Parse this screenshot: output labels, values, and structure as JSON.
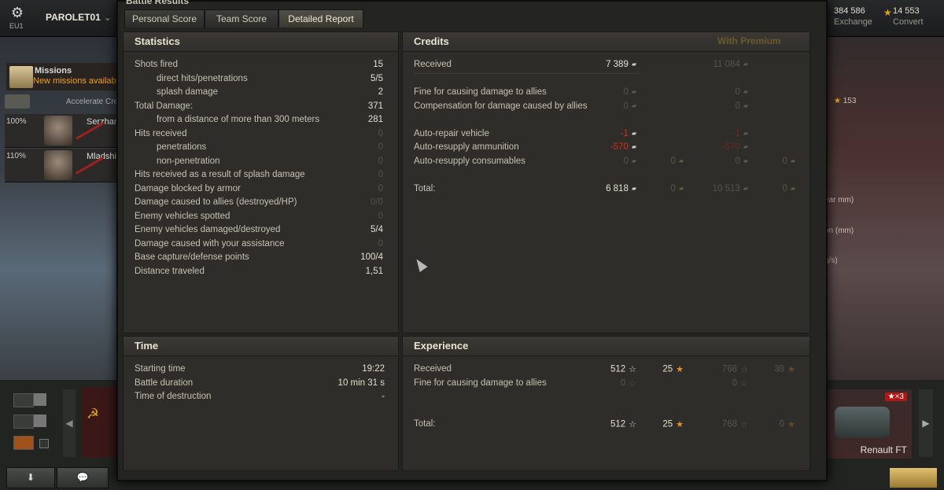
{
  "topbar": {
    "region": "EU1",
    "player": "PAROLET01",
    "silver_value": "384 586",
    "silver_label": "Exchange",
    "gold_value": "14 553",
    "gold_label": "Convert"
  },
  "left": {
    "missions_title": "Missions",
    "missions_sub": "New missions availabl",
    "accelerate": "Accelerate Crev",
    "crew": [
      {
        "pct": "100%",
        "name": "Serzhan"
      },
      {
        "pct": "110%",
        "name": "Mladshi"
      }
    ]
  },
  "right": {
    "stat_153": "153",
    "frag1": "ear mm)",
    "frag2": "on (mm)",
    "frag3": "g/s)",
    "tank_name": "Renault FT",
    "tank_xp": "×3"
  },
  "dialog": {
    "title": "Battle Results",
    "tabs": [
      "Personal Score",
      "Team Score",
      "Detailed Report"
    ]
  },
  "statistics": {
    "title": "Statistics",
    "rows": [
      {
        "label": "Shots fired",
        "value": "15",
        "indent": false,
        "bright": true
      },
      {
        "label": "direct hits/penetrations",
        "value": "5/5",
        "indent": true,
        "bright": true
      },
      {
        "label": "splash damage",
        "value": "2",
        "indent": true,
        "bright": true
      },
      {
        "label": "Total Damage:",
        "value": "371",
        "indent": false,
        "bright": true
      },
      {
        "label": "from a distance of more than 300 meters",
        "value": "281",
        "indent": true,
        "bright": true
      },
      {
        "label": "Hits received",
        "value": "0",
        "indent": false,
        "bright": false
      },
      {
        "label": "penetrations",
        "value": "0",
        "indent": true,
        "bright": false
      },
      {
        "label": "non-penetration",
        "value": "0",
        "indent": true,
        "bright": false
      },
      {
        "label": "Hits received as a result of splash damage",
        "value": "0",
        "indent": false,
        "bright": false
      },
      {
        "label": "Damage blocked by armor",
        "value": "0",
        "indent": false,
        "bright": false
      },
      {
        "label": "Damage caused to allies (destroyed/HP)",
        "value": "0/0",
        "indent": false,
        "bright": false
      },
      {
        "label": "Enemy vehicles spotted",
        "value": "0",
        "indent": false,
        "bright": false
      },
      {
        "label": "Enemy vehicles damaged/destroyed",
        "value": "5/4",
        "indent": false,
        "bright": true
      },
      {
        "label": "Damage caused with your assistance",
        "value": "0",
        "indent": false,
        "bright": false
      },
      {
        "label": "Base capture/defense points",
        "value": "100/4",
        "indent": false,
        "bright": true
      },
      {
        "label": "Distance traveled",
        "value": "1,51",
        "indent": false,
        "bright": true
      }
    ]
  },
  "credits": {
    "title": "Credits",
    "premium_label": "With Premium",
    "received": {
      "label": "Received",
      "value": "7 389",
      "premium": "11 084"
    },
    "fine": {
      "label": "Fine for causing damage to allies",
      "value": "0",
      "premium": "0"
    },
    "compensation": {
      "label": "Compensation for damage caused by allies",
      "value": "0",
      "premium": "0"
    },
    "repair": {
      "label": "Auto-repair vehicle",
      "value": "-1",
      "premium": "-1"
    },
    "ammo": {
      "label": "Auto-resupply ammunition",
      "value": "-570",
      "premium": "-570"
    },
    "consumables": {
      "label": "Auto-resupply consumables",
      "value": "0",
      "gold": "0",
      "premium": "0",
      "premium_gold": "0"
    },
    "total": {
      "label": "Total:",
      "value": "6 818",
      "gold": "0",
      "premium": "10 513",
      "premium_gold": "0"
    }
  },
  "time": {
    "title": "Time",
    "rows": [
      {
        "label": "Starting time",
        "value": "19:22"
      },
      {
        "label": "Battle duration",
        "value": "10 min 31 s"
      },
      {
        "label": "Time of destruction",
        "value": "-"
      }
    ]
  },
  "experience": {
    "title": "Experience",
    "received": {
      "label": "Received",
      "xp": "512",
      "free": "25",
      "premium_xp": "768",
      "premium_free": "38"
    },
    "fine": {
      "label": "Fine for causing damage to allies",
      "xp": "0",
      "premium_xp": "0"
    },
    "total": {
      "label": "Total:",
      "xp": "512",
      "free": "25",
      "premium_xp": "768",
      "premium_free": "0"
    }
  }
}
